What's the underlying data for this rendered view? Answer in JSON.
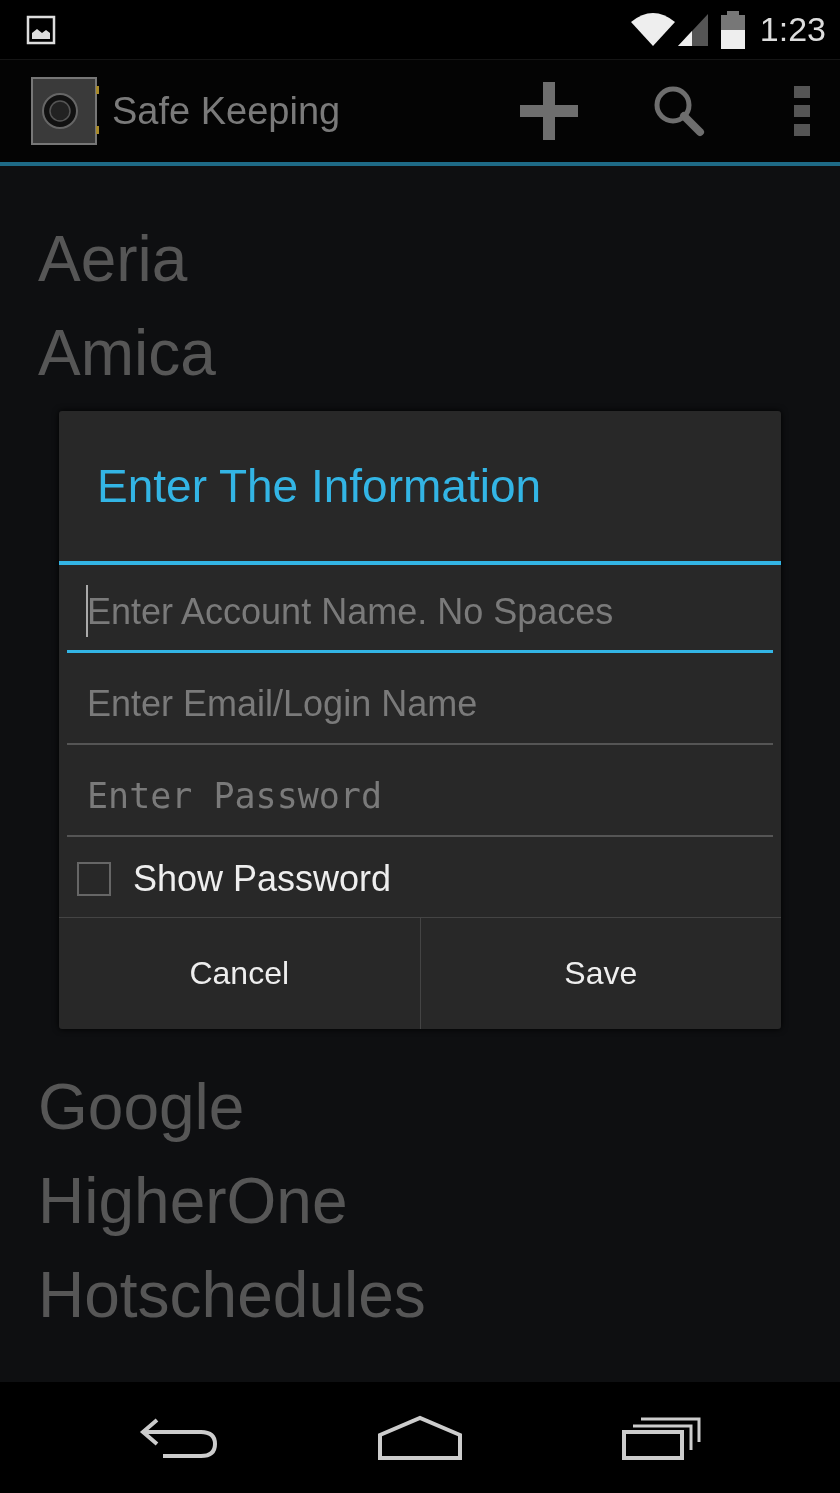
{
  "status_bar": {
    "time": "1:23"
  },
  "action_bar": {
    "title": "Safe Keeping"
  },
  "list_top": [
    "Aeria",
    "Amica"
  ],
  "dialog": {
    "title": "Enter The Information",
    "fields": [
      {
        "placeholder": "Enter Account Name. No Spaces",
        "kind": "text",
        "focused": true
      },
      {
        "placeholder": "Enter Email/Login Name",
        "kind": "text",
        "focused": false
      },
      {
        "placeholder": "Enter Password",
        "kind": "password",
        "focused": false
      }
    ],
    "checkbox": {
      "label": "Show Password",
      "checked": false
    },
    "buttons": [
      "Cancel",
      "Save"
    ]
  },
  "list_bottom": [
    "Google",
    "HigherOne",
    "Hotschedules"
  ]
}
